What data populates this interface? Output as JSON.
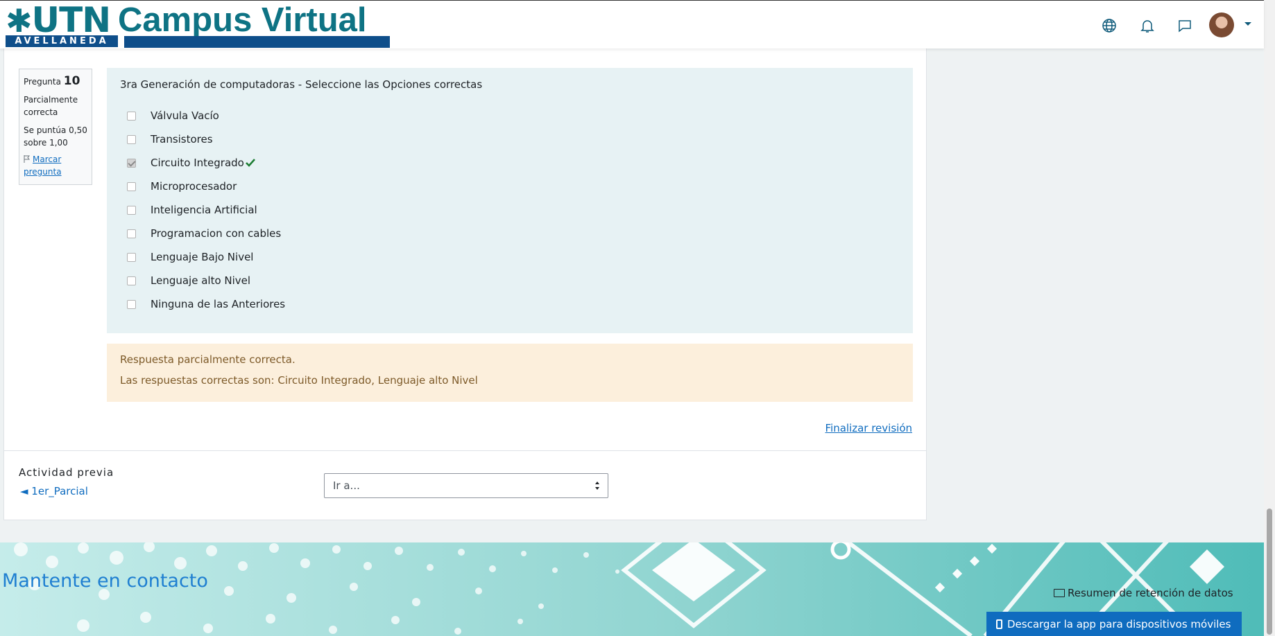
{
  "header": {
    "logo_utn": "UTN",
    "logo_city": "AVELLANEDA",
    "logo_title": "Campus Virtual",
    "icons": [
      "globe-icon",
      "bell-icon",
      "chat-icon",
      "avatar",
      "chevron-down-icon"
    ]
  },
  "question": {
    "label": "Pregunta",
    "number": "10",
    "state": "Parcialmente correcta",
    "grade": "Se puntúa 0,50 sobre 1,00",
    "flag_label": "Marcar pregunta",
    "text": "3ra Generación de computadoras - Seleccione las Opciones correctas",
    "answers": [
      {
        "label": "Válvula Vacío",
        "checked": false,
        "correct_mark": false
      },
      {
        "label": "Transistores",
        "checked": false,
        "correct_mark": false
      },
      {
        "label": "Circuito Integrado",
        "checked": true,
        "correct_mark": true
      },
      {
        "label": "Microprocesador",
        "checked": false,
        "correct_mark": false
      },
      {
        "label": "Inteligencia Artificial",
        "checked": false,
        "correct_mark": false
      },
      {
        "label": "Programacion con cables",
        "checked": false,
        "correct_mark": false
      },
      {
        "label": "Lenguaje Bajo Nivel",
        "checked": false,
        "correct_mark": false
      },
      {
        "label": "Lenguaje alto Nivel",
        "checked": false,
        "correct_mark": false
      },
      {
        "label": "Ninguna de las Anteriores",
        "checked": false,
        "correct_mark": false
      }
    ]
  },
  "feedback": {
    "line1": "Respuesta parcialmente correcta.",
    "line2": "Las respuestas correctas son: Circuito Integrado, Lenguaje alto Nivel"
  },
  "navigation": {
    "finish_review": "Finalizar revisión",
    "prev_activity_label": "Actividad previa",
    "prev_activity_link": "◄ 1er_Parcial",
    "jump_select_value": "Ir a..."
  },
  "footer": {
    "contact": "Mantente en contacto",
    "retention": "Resumen de retención de datos",
    "app_button": "Descargar la app para dispositivos móviles"
  },
  "colors": {
    "brand_teal": "#0e7384",
    "brand_blue": "#0e4e8a",
    "link_blue": "#0f6cbf",
    "formulation_bg": "#e7f2f4",
    "feedback_bg": "#fcefdc",
    "correct_green": "#1e7e34"
  }
}
